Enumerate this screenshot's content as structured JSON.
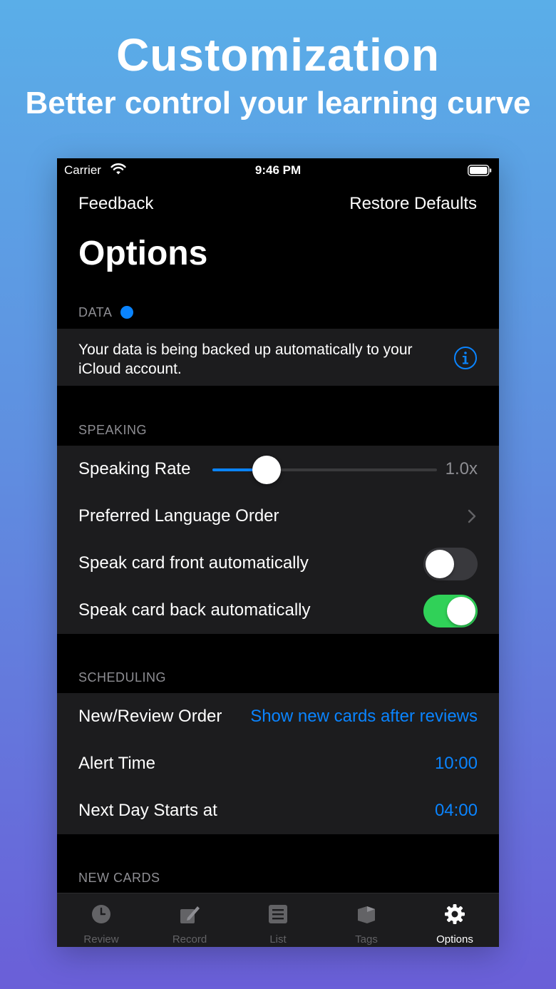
{
  "promo": {
    "title": "Customization",
    "subtitle": "Better control your learning curve"
  },
  "status_bar": {
    "carrier": "Carrier",
    "time": "9:46 PM"
  },
  "nav": {
    "left": "Feedback",
    "right": "Restore Defaults",
    "title": "Options"
  },
  "sections": {
    "data": {
      "header": "DATA",
      "info_text": "Your data is being backed up automatically to your iCloud account."
    },
    "speaking": {
      "header": "SPEAKING",
      "rate_label": "Speaking Rate",
      "rate_value": "1.0x",
      "rate_fraction": 0.24,
      "language_order_label": "Preferred Language Order",
      "front_label": "Speak card front automatically",
      "front_on": false,
      "back_label": "Speak card back automatically",
      "back_on": true
    },
    "scheduling": {
      "header": "SCHEDULING",
      "order_label": "New/Review Order",
      "order_value": "Show new cards after reviews",
      "alert_label": "Alert Time",
      "alert_value": "10:00",
      "next_day_label": "Next Day Starts at",
      "next_day_value": "04:00"
    },
    "new_cards": {
      "header": "NEW CARDS"
    }
  },
  "tabs": [
    {
      "label": "Review",
      "icon": "clock-icon"
    },
    {
      "label": "Record",
      "icon": "pencil-icon"
    },
    {
      "label": "List",
      "icon": "list-icon"
    },
    {
      "label": "Tags",
      "icon": "tag-icon"
    },
    {
      "label": "Options",
      "icon": "gear-icon"
    }
  ],
  "colors": {
    "accent": "#0a84ff",
    "toggle_on": "#30d158"
  }
}
